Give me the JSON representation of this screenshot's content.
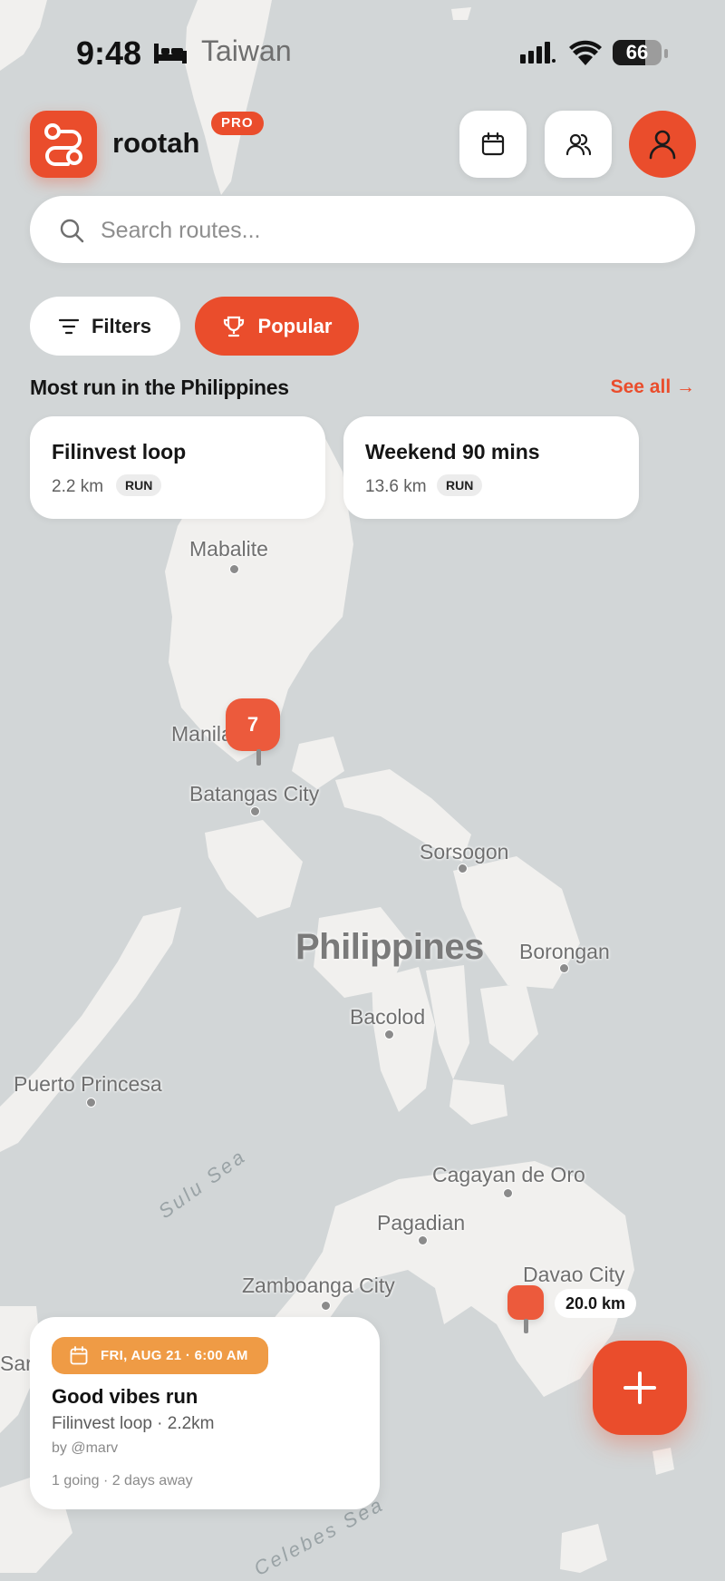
{
  "status_bar": {
    "time": "9:48",
    "carrier": "Taiwan",
    "battery_level": "66",
    "battery_fraction": 0.66
  },
  "header": {
    "brand": "rootah",
    "badge": "PRO",
    "calendar_icon": "calendar-icon",
    "friends_icon": "users-icon",
    "profile_icon": "user-icon",
    "accent_color": "#ea4d2c"
  },
  "search": {
    "placeholder": "Search routes...",
    "value": ""
  },
  "chips": {
    "filters_label": "Filters",
    "popular_label": "Popular"
  },
  "section": {
    "title": "Most run in the Philippines",
    "see_all": "See all →"
  },
  "routes": [
    {
      "name": "Filinvest loop",
      "distance": "2.2 km",
      "type": "RUN"
    },
    {
      "name": "Weekend 90 mins",
      "distance": "13.6 km",
      "type": "RUN"
    }
  ],
  "map": {
    "country": "Philippines",
    "cities": [
      "Mabalite",
      "Manila",
      "Batangas City",
      "Sorsogon",
      "Borongan",
      "Bacolod",
      "Puerto Princesa",
      "Cagayan de Oro",
      "Pagadian",
      "Zamboanga City",
      "Davao City",
      "Sar"
    ],
    "seas": [
      "Sulu Sea",
      "Celebes Sea"
    ],
    "cluster_count": "7",
    "pin_distance": "20.0 km"
  },
  "event": {
    "date": "FRI, AUG 21 · 6:00 AM",
    "title": "Good vibes run",
    "subtitle": "Filinvest loop · 2.2km",
    "author": "by @marv",
    "meta": "1 going · 2 days away",
    "date_color": "#ef9b45"
  },
  "fab": {
    "icon": "plus-icon"
  }
}
